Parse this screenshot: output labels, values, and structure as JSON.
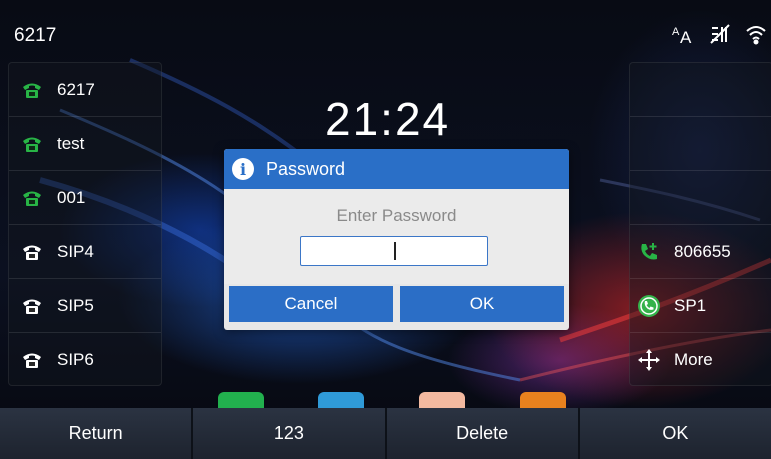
{
  "status_bar": {
    "account": "6217",
    "icons": [
      "font-size-icon",
      "network-off-icon",
      "wifi-icon"
    ]
  },
  "left_lines": [
    {
      "label": "6217",
      "icon": "phone-green-icon"
    },
    {
      "label": "test",
      "icon": "phone-green-icon"
    },
    {
      "label": "001",
      "icon": "phone-green-icon"
    },
    {
      "label": "SIP4",
      "icon": "phone-white-icon"
    },
    {
      "label": "SIP5",
      "icon": "phone-white-icon"
    },
    {
      "label": "SIP6",
      "icon": "phone-white-icon"
    }
  ],
  "right_keys": [
    {
      "label": "806655",
      "icon": "speed-dial-icon"
    },
    {
      "label": "SP1",
      "icon": "call-circle-icon"
    },
    {
      "label": "More",
      "icon": "more-arrows-icon"
    }
  ],
  "clock": {
    "time": "21:24"
  },
  "dialog": {
    "title": "Password",
    "prompt": "Enter Password",
    "input_value": "",
    "cancel_label": "Cancel",
    "ok_label": "OK"
  },
  "softkeys": {
    "return_label": "Return",
    "ime_label": "123",
    "delete_label": "Delete",
    "ok_label": "OK"
  },
  "colors": {
    "dialog_header": "#2a6fc7",
    "dialog_button": "#2b6ec6",
    "line_green": "#28b446"
  }
}
